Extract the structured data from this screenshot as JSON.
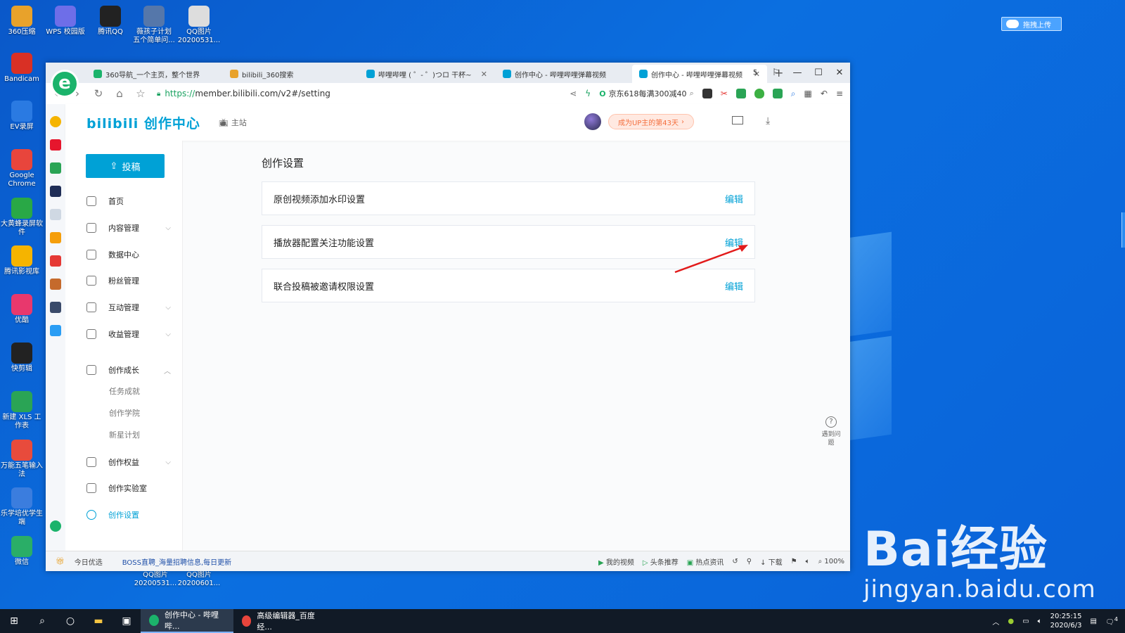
{
  "desktop": {
    "left_icons": [
      {
        "label": "360压缩",
        "color": "#e8a22b"
      },
      {
        "label": "Bandicam",
        "color": "#d93025"
      },
      {
        "label": "EV录屏",
        "color": "#2a7ae2"
      },
      {
        "label": "Google Chrome",
        "color": "#e8453c"
      },
      {
        "label": "大黄蜂录屏软件",
        "color": "#29a846"
      },
      {
        "label": "腾讯影视库",
        "color": "#f5b400"
      },
      {
        "label": "优酷",
        "color": "#e8386d"
      },
      {
        "label": "快剪辑",
        "color": "#222222"
      },
      {
        "label": "新建 XLS 工作表",
        "color": "#2aa455"
      },
      {
        "label": "万能五笔输入法",
        "color": "#e84b3c"
      },
      {
        "label": "乐学培优学生端",
        "color": "#3b7dde"
      },
      {
        "label": "微信",
        "color": "#2aae67"
      }
    ],
    "top_icons": [
      {
        "label": "WPS 校园版",
        "color": "#6e6ee8"
      },
      {
        "label": "腾讯QQ",
        "color": "#222222"
      },
      {
        "label": "薇孩子计划 五个简单问...",
        "color": "#5577aa"
      },
      {
        "label": "QQ图片20200531...",
        "color": "#dddddd"
      }
    ],
    "bottom_icons": [
      {
        "label": "QQ图片20200531..."
      },
      {
        "label": "QQ图片20200601..."
      }
    ],
    "upload_button": "拖拽上传",
    "watermark_main": "Bai经验",
    "watermark_url": "jingyan.baidu.com"
  },
  "browser": {
    "tabs": [
      {
        "label": "360导航_一个主页，整个世界",
        "favicon_color": "#1bb36b",
        "active": false
      },
      {
        "label": "bilibili_360搜索",
        "favicon_color": "#e8a22b",
        "active": false
      },
      {
        "label": "哔哩哔哩 ( ゜- ゜)つロ 干杯~",
        "favicon_color": "#00a1d6",
        "active": false
      },
      {
        "label": "创作中心 - 哔哩哔哩弹幕视频",
        "favicon_color": "#00a1d6",
        "active": false
      },
      {
        "label": "创作中心 - 哔哩哔哩弹幕视频",
        "favicon_color": "#00a1d6",
        "active": true
      }
    ],
    "tab_count": "5",
    "url_scheme": "https://",
    "url_rest": "member.bilibili.com/v2#/setting",
    "search_hint": "京东618每满300减40",
    "status_left": [
      "今日优选",
      "BOSS直聘_海量招聘信息,每日更新"
    ],
    "status_right": [
      "我的视频",
      "头条推荐",
      "热点资讯",
      "下载"
    ],
    "zoom": "100%"
  },
  "page": {
    "brand": "bilibili 创作中心",
    "main_site": "主站",
    "up_badge": "成为UP主的第43天",
    "post_button": "投稿",
    "nav": [
      {
        "label": "首页",
        "chevron": ""
      },
      {
        "label": "内容管理",
        "chevron": "⌵"
      },
      {
        "label": "数据中心",
        "chevron": ""
      },
      {
        "label": "粉丝管理",
        "chevron": ""
      },
      {
        "label": "互动管理",
        "chevron": "⌵"
      },
      {
        "label": "收益管理",
        "chevron": "⌵"
      },
      {
        "label": "创作成长",
        "chevron": "︿"
      },
      {
        "label": "创作权益",
        "chevron": "⌵"
      },
      {
        "label": "创作实验室",
        "chevron": ""
      },
      {
        "label": "创作设置",
        "chevron": ""
      }
    ],
    "sub_nav": [
      "任务成就",
      "创作学院",
      "新星计划"
    ],
    "content_title": "创作设置",
    "settings": [
      {
        "label": "原创视频添加水印设置",
        "action": "编辑"
      },
      {
        "label": "播放器配置关注功能设置",
        "action": "编辑"
      },
      {
        "label": "联合投稿被邀请权限设置",
        "action": "编辑"
      }
    ],
    "help": "遇到问题",
    "accent": "#00a1d6"
  },
  "taskbar": {
    "apps": [
      {
        "label": "创作中心 - 哔哩哔...",
        "color": "#1bb36b",
        "active": true
      },
      {
        "label": "高级编辑器_百度经...",
        "color": "#e8453c",
        "active": false
      }
    ],
    "time": "20:25:15",
    "date": "2020/6/3",
    "notify_count": "4"
  }
}
